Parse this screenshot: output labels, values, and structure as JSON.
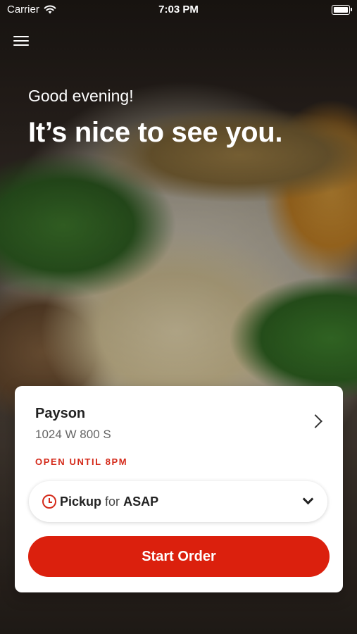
{
  "status_bar": {
    "carrier": "Carrier",
    "time": "7:03 PM"
  },
  "header": {
    "greeting": "Good evening!",
    "headline": "It’s nice to see you."
  },
  "store": {
    "name": "Payson",
    "address": "1024 W 800 S",
    "open_status": "OPEN UNTIL 8PM"
  },
  "order_mode": {
    "mode": "Pickup",
    "connector": "for",
    "time": "ASAP"
  },
  "actions": {
    "start_order_label": "Start Order"
  },
  "colors": {
    "accent": "#db200d",
    "status_text": "#d42a1a",
    "card_bg": "#ffffff"
  },
  "icons": {
    "menu": "hamburger-menu-icon",
    "wifi": "wifi-icon",
    "battery": "battery-icon",
    "store_chevron": "chevron-right-icon",
    "clock": "clock-icon",
    "dropdown": "chevron-down-icon"
  }
}
